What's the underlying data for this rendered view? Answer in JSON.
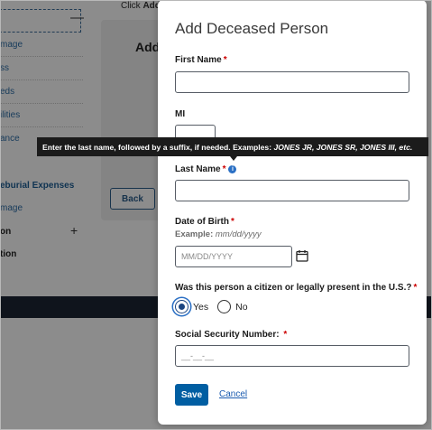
{
  "background": {
    "top_text_prefix": "Click",
    "top_text_bold": "Add",
    "sidebar_links": [
      "mage",
      "ss",
      "eds",
      "ilities",
      "ance"
    ],
    "sidebar_bold_link": "eburial Expenses",
    "sidebar_link_after": "mage",
    "sidebar_dark_items": [
      "on",
      "tion"
    ],
    "card_title": "Add",
    "back_button": "Back"
  },
  "modal": {
    "title": "Add Deceased Person",
    "first_name_label": "First Name",
    "mi_label": "MI",
    "last_name_label": "Last Name",
    "dob_label": "Date of Birth",
    "dob_hint_prefix": "Example:",
    "dob_hint_value": "mm/dd/yyyy",
    "dob_placeholder": "MM/DD/YYYY",
    "citizen_question": "Was this person a citizen or legally present in the U.S.?",
    "radio_yes": "Yes",
    "radio_no": "No",
    "ssn_label": "Social Security Number:",
    "ssn_placeholder": "__-__-__",
    "required_mark": "*",
    "save_button": "Save",
    "cancel_link": "Cancel",
    "selected_option": "Yes"
  },
  "tooltip": {
    "text": "Enter the last name, followed by a suffix, if needed. Examples:",
    "examples": "JONES JR, JONES SR, JONES III, etc."
  },
  "icons": {
    "info": "info-icon",
    "calendar": "calendar-icon"
  },
  "colors": {
    "primary": "#005ea2",
    "required": "#cc0000",
    "footer": "#1d2633"
  }
}
